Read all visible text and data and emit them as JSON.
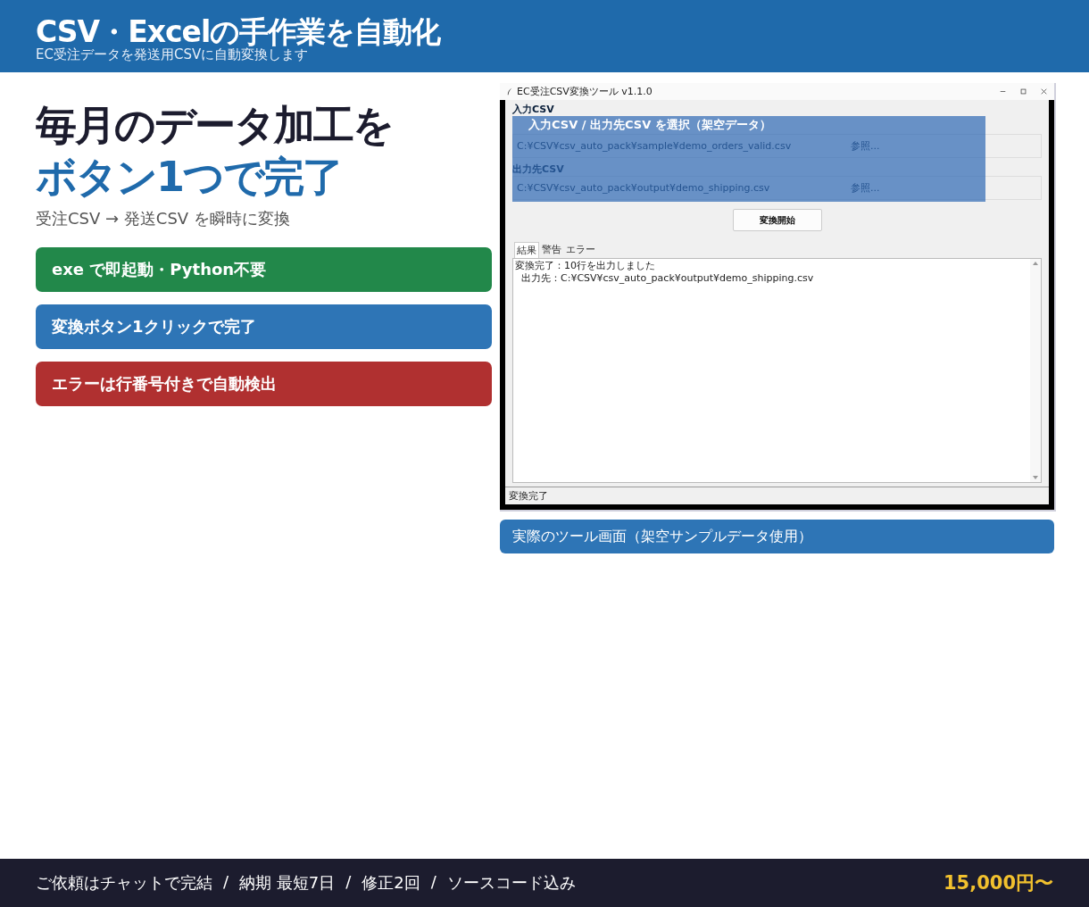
{
  "header": {
    "title": "CSV・Excelの手作業を自動化",
    "subtitle": "EC受注データを発送用CSVに自動変換します"
  },
  "hero": {
    "headline_1": "毎月のデータ加工を",
    "headline_2": "ボタン1つで完了",
    "subline": "受注CSV → 発送CSV を瞬時に変換"
  },
  "features": [
    {
      "text": "exe で即起動・Python不要",
      "color": "#22884a"
    },
    {
      "text": "変換ボタン1クリックで完了",
      "color": "#2e75b6"
    },
    {
      "text": "エラーは行番号付きで自動検出",
      "color": "#b03030"
    }
  ],
  "app_window": {
    "title": "EC受注CSV変換ツール  v1.1.0",
    "fields": [
      {
        "label": "入力CSV",
        "value": "C:¥CSV¥csv_auto_pack¥sample¥demo_orders_valid.csv",
        "button": "参照..."
      },
      {
        "label": "出力先CSV",
        "value": "C:¥CSV¥csv_auto_pack¥output¥demo_shipping.csv",
        "button": "参照..."
      }
    ],
    "convert_button": "変換開始",
    "tabs": [
      {
        "label": "結果",
        "selected": true
      },
      {
        "label": "警告",
        "selected": false
      },
      {
        "label": "エラー",
        "selected": false
      }
    ],
    "log": [
      "変換完了：10行を出力しました",
      "  出力先：C:¥CSV¥csv_auto_pack¥output¥demo_shipping.csv"
    ],
    "status": "変換完了",
    "overlay_caption": "入力CSV / 出力先CSV を選択（架空データ）"
  },
  "caption": "実際のツール画面（架空サンプルデータ使用）",
  "footer": {
    "items": [
      "ご依頼はチャットで完結",
      "納期 最短7日",
      "修正2回",
      "ソースコード込み"
    ],
    "separator": "/",
    "price": "15,000円〜"
  }
}
